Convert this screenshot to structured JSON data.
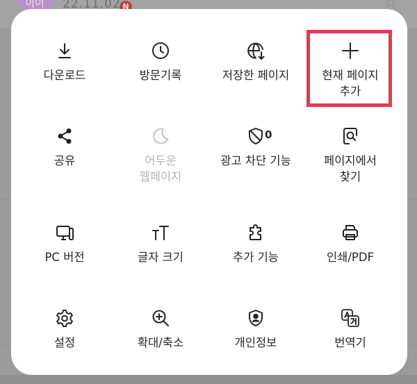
{
  "background": {
    "avatar_text": "이이",
    "date_text": "22.11.02",
    "badge_text": "N"
  },
  "colors": {
    "sheet": "#ffffff",
    "highlight": "#e23a4f",
    "disabled": "#b4b4b4"
  },
  "menu": {
    "items": [
      {
        "label": "다운로드",
        "icon": "download-icon",
        "enabled": true
      },
      {
        "label": "방문기록",
        "icon": "history-clock-icon",
        "enabled": true
      },
      {
        "label": "저장한 페이지",
        "icon": "saved-page-globe-icon",
        "enabled": true
      },
      {
        "label": "현재 페이지\n추가",
        "icon": "plus-icon",
        "enabled": true,
        "highlighted": true
      },
      {
        "label": "공유",
        "icon": "share-icon",
        "enabled": true
      },
      {
        "label": "어두운\n웹페이지",
        "icon": "moon-icon",
        "enabled": false
      },
      {
        "label": "광고 차단 기능",
        "icon": "ad-block-shield-icon",
        "enabled": true,
        "count": "0"
      },
      {
        "label": "페이지에서\n찾기",
        "icon": "find-in-page-icon",
        "enabled": true
      },
      {
        "label": "PC 버전",
        "icon": "desktop-monitor-icon",
        "enabled": true
      },
      {
        "label": "글자 크기",
        "icon": "text-size-icon",
        "enabled": true
      },
      {
        "label": "추가 기능",
        "icon": "puzzle-icon",
        "enabled": true
      },
      {
        "label": "인쇄/PDF",
        "icon": "printer-icon",
        "enabled": true
      },
      {
        "label": "설정",
        "icon": "gear-icon",
        "enabled": true
      },
      {
        "label": "확대/축소",
        "icon": "zoom-in-icon",
        "enabled": true
      },
      {
        "label": "개인정보",
        "icon": "privacy-shield-person-icon",
        "enabled": true
      },
      {
        "label": "번역기",
        "icon": "translate-icon",
        "enabled": true
      }
    ]
  }
}
